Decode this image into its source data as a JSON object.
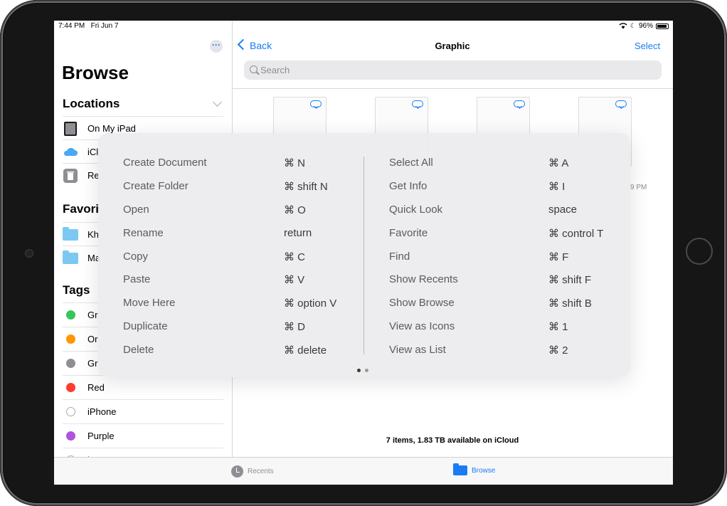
{
  "status": {
    "time": "7:44 PM",
    "date": "Fri Jun 7",
    "battery": "96%"
  },
  "sidebar": {
    "title": "Browse",
    "locations_header": "Locations",
    "locations": [
      "On My iPad",
      "iCl",
      "Re"
    ],
    "favorites_header": "Favori",
    "favorites": [
      "Kh",
      "Ma"
    ],
    "tags_header": "Tags",
    "tags": [
      {
        "label": "Gr",
        "color": "#34c759"
      },
      {
        "label": "Or",
        "color": "#ff9500"
      },
      {
        "label": "Gr",
        "color": "#8e8e93"
      },
      {
        "label": "Red",
        "color": "#ff3b30"
      },
      {
        "label": "iPhone",
        "color": ""
      },
      {
        "label": "Purple",
        "color": "#af52de"
      },
      {
        "label": "iT",
        "color": ""
      }
    ]
  },
  "nav": {
    "back": "Back",
    "title": "Graphic",
    "select": "Select"
  },
  "search": {
    "placeholder": "Search"
  },
  "files": {
    "time_fragment": "9 PM"
  },
  "storage": "7 items, 1.83 TB available on iCloud",
  "tabs": {
    "recents": "Recents",
    "browse": "Browse"
  },
  "shortcuts": {
    "left": [
      {
        "action": "Create Document",
        "keys": "⌘ N"
      },
      {
        "action": "Create Folder",
        "keys": "⌘ shift N"
      },
      {
        "action": "Open",
        "keys": "⌘ O"
      },
      {
        "action": "Rename",
        "keys": "return"
      },
      {
        "action": "Copy",
        "keys": "⌘ C"
      },
      {
        "action": "Paste",
        "keys": "⌘ V"
      },
      {
        "action": "Move Here",
        "keys": "⌘ option V"
      },
      {
        "action": "Duplicate",
        "keys": "⌘ D"
      },
      {
        "action": "Delete",
        "keys": "⌘ delete"
      }
    ],
    "right": [
      {
        "action": "Select All",
        "keys": "⌘ A"
      },
      {
        "action": "Get Info",
        "keys": "⌘ I"
      },
      {
        "action": "Quick Look",
        "keys": "space"
      },
      {
        "action": "Favorite",
        "keys": "⌘ control T"
      },
      {
        "action": "Find",
        "keys": "⌘ F"
      },
      {
        "action": "Show Recents",
        "keys": "⌘ shift F"
      },
      {
        "action": "Show Browse",
        "keys": "⌘ shift B"
      },
      {
        "action": "View as Icons",
        "keys": "⌘ 1"
      },
      {
        "action": "View as List",
        "keys": "⌘ 2"
      }
    ]
  },
  "colors": {
    "accent": "#1a7cf5"
  }
}
